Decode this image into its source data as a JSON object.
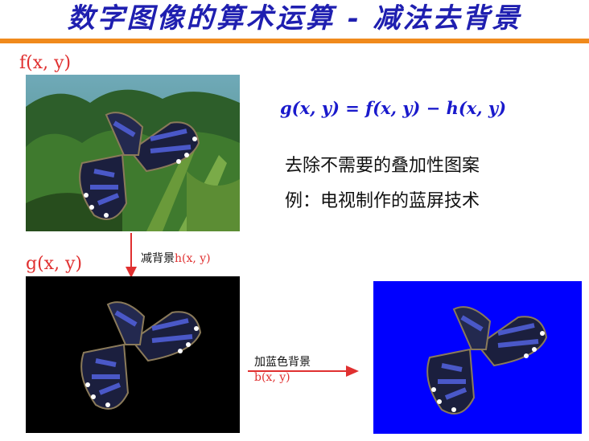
{
  "title": "数字图像的算术运算 - 减法去背景",
  "labels": {
    "f": "f(x, y)",
    "g": "g(x, y)"
  },
  "formula": "g(x, y) = f(x, y) − h(x, y)",
  "description": [
    "去除不需要的叠加性图案",
    "例：电视制作的蓝屏技术"
  ],
  "arrow_subtract": {
    "text": "减背景",
    "red": "h(x, y)"
  },
  "arrow_add": {
    "text": "加蓝色背景",
    "red": "b(x, y)"
  },
  "colors": {
    "title": "#1f1fb0",
    "rule": "#f08a1c",
    "label_red": "#e03030",
    "formula": "#1a1acc",
    "blue_bg": "#0000ff"
  }
}
